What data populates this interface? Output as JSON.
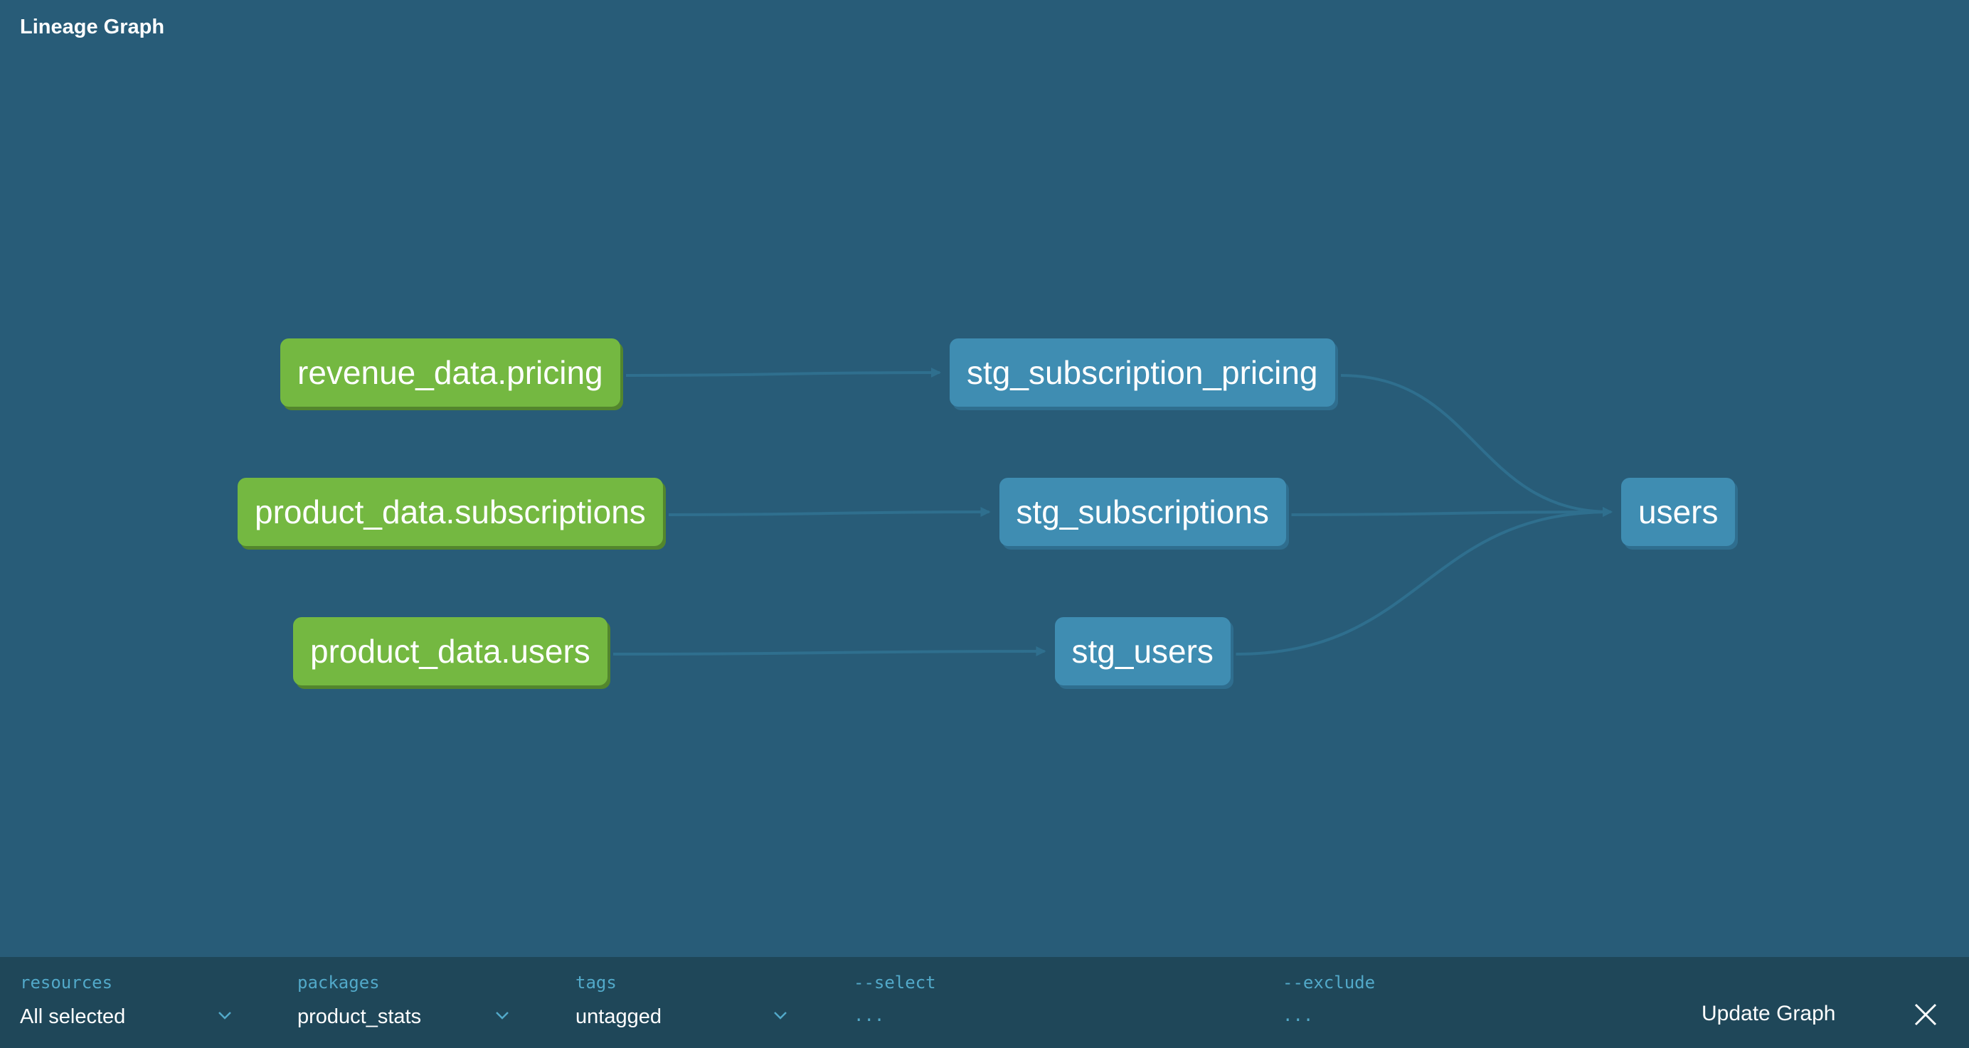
{
  "header": {
    "title": "Lineage Graph"
  },
  "graph": {
    "nodes": [
      {
        "id": "revenue_data.pricing",
        "label": "revenue_data.pricing",
        "kind": "source",
        "color": "#74b841"
      },
      {
        "id": "product_data.subscriptions",
        "label": "product_data.subscriptions",
        "kind": "source",
        "color": "#74b841"
      },
      {
        "id": "product_data.users",
        "label": "product_data.users",
        "kind": "source",
        "color": "#74b841"
      },
      {
        "id": "stg_subscription_pricing",
        "label": "stg_subscription_pricing",
        "kind": "model",
        "color": "#3f8db2"
      },
      {
        "id": "stg_subscriptions",
        "label": "stg_subscriptions",
        "kind": "model",
        "color": "#3f8db2"
      },
      {
        "id": "stg_users",
        "label": "stg_users",
        "kind": "model",
        "color": "#3f8db2"
      },
      {
        "id": "users",
        "label": "users",
        "kind": "model",
        "color": "#3f8db2"
      }
    ],
    "edges": [
      {
        "from": "revenue_data.pricing",
        "to": "stg_subscription_pricing"
      },
      {
        "from": "product_data.subscriptions",
        "to": "stg_subscriptions"
      },
      {
        "from": "product_data.users",
        "to": "stg_users"
      },
      {
        "from": "stg_subscription_pricing",
        "to": "users"
      },
      {
        "from": "stg_subscriptions",
        "to": "users"
      },
      {
        "from": "stg_users",
        "to": "users"
      }
    ],
    "edge_color": "#2f6f8e"
  },
  "filters": {
    "resources": {
      "label": "resources",
      "value": "All selected"
    },
    "packages": {
      "label": "packages",
      "value": "product_stats"
    },
    "tags": {
      "label": "tags",
      "value": "untagged"
    },
    "select": {
      "label": "--select",
      "placeholder": "..."
    },
    "exclude": {
      "label": "--exclude",
      "placeholder": "..."
    }
  },
  "actions": {
    "update_label": "Update Graph",
    "close_icon": "close-icon"
  }
}
